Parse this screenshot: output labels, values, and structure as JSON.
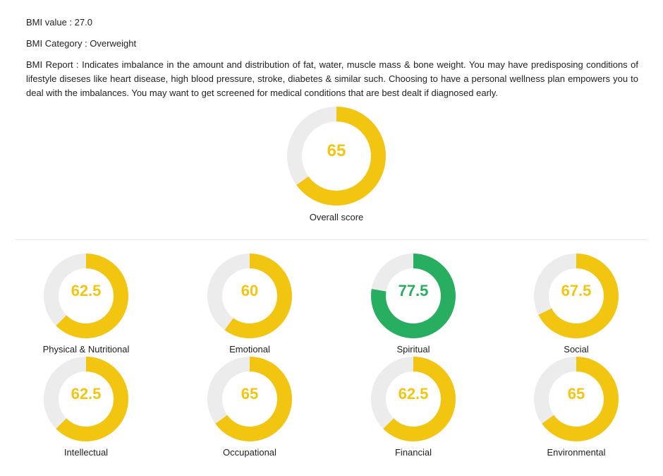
{
  "bmi": {
    "value_line": "BMI value : 27.0",
    "category_line": "BMI Category : Overweight",
    "report_line": "BMI Report : Indicates imbalance in the amount and distribution of fat, water, muscle mass & bone weight. You may have predisposing conditions of lifestyle diseses like heart disease, high blood pressure, stroke, diabetes & similar such. Choosing to have a personal wellness plan empowers you to deal with the imbalances. You may want to get screened for medical conditions that are best dealt if diagnosed early."
  },
  "colors": {
    "yellow": "#f2c511",
    "green": "#27ae60",
    "track": "#ececec"
  },
  "chart_data": {
    "type": "donut",
    "max": 100,
    "overall": {
      "label": "Overall score",
      "value": 65,
      "color": "#f2c511"
    },
    "dimensions": [
      {
        "label": "Physical & Nutritional",
        "value": 62.5,
        "display": "62.5",
        "color": "#f2c511"
      },
      {
        "label": "Emotional",
        "value": 60,
        "display": "60",
        "color": "#f2c511"
      },
      {
        "label": "Spiritual",
        "value": 77.5,
        "display": "77.5",
        "color": "#27ae60"
      },
      {
        "label": "Social",
        "value": 67.5,
        "display": "67.5",
        "color": "#f2c511"
      },
      {
        "label": "Intellectual",
        "value": 62.5,
        "display": "62.5",
        "color": "#f2c511"
      },
      {
        "label": "Occupational",
        "value": 65,
        "display": "65",
        "color": "#f2c511"
      },
      {
        "label": "Financial",
        "value": 62.5,
        "display": "62.5",
        "color": "#f2c511"
      },
      {
        "label": "Environmental",
        "value": 65,
        "display": "65",
        "color": "#f2c511"
      }
    ]
  }
}
